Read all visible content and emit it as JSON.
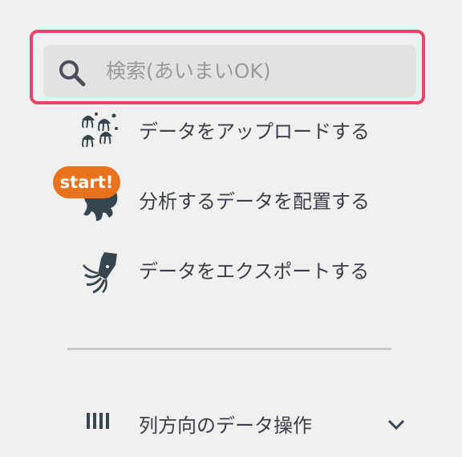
{
  "search": {
    "placeholder": "検索(あいまいOK)",
    "icon": "search-icon",
    "highlight_color": "#e8436b"
  },
  "menu": {
    "items": [
      {
        "label": "データをアップロードする",
        "icon": "jellyfish-icon"
      },
      {
        "label": "分析するデータを配置する",
        "icon": "octopus-icon",
        "badge": "start!"
      },
      {
        "label": "データをエクスポートする",
        "icon": "squid-icon"
      }
    ]
  },
  "section": {
    "label": "列方向のデータ操作",
    "icon": "columns-icon",
    "toggle_icon": "chevron-down-icon"
  },
  "colors": {
    "text": "#3a3f4a",
    "badge": "#e8731e",
    "background": "#f0f0f0"
  }
}
